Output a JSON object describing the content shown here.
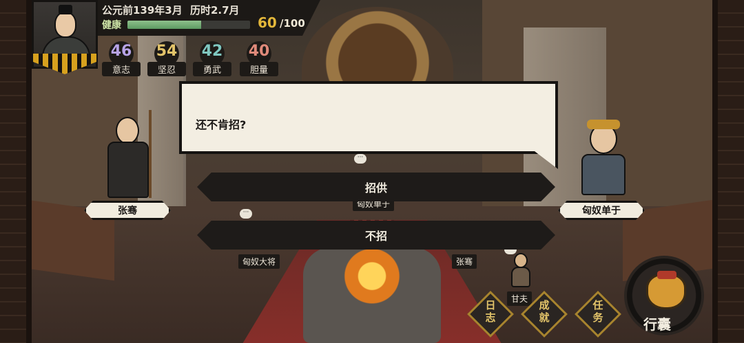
{
  "hud": {
    "date": "公元前139年3月",
    "elapsed": "历时2.7月",
    "health_label": "健康",
    "health_value": "60",
    "health_max": "/100",
    "health_fraction": 0.6
  },
  "stats": [
    {
      "value": "46",
      "label": "意志",
      "color": "#b7a3e6"
    },
    {
      "value": "54",
      "label": "坚忍",
      "color": "#e3c46a"
    },
    {
      "value": "42",
      "label": "勇武",
      "color": "#7fc7c0"
    },
    {
      "value": "40",
      "label": "胆量",
      "color": "#e08a7a"
    }
  ],
  "dialog": {
    "text": "还不肯招?"
  },
  "choices": [
    {
      "label": "招供"
    },
    {
      "label": "不招"
    }
  ],
  "characters": {
    "left_name": "张骞",
    "right_name": "匈奴单于",
    "center_back_tag": "匈奴单于",
    "general_tag": "匈奴大将",
    "zhangqian_tag": "张骞",
    "ganfu_tag": "甘夫"
  },
  "menu": {
    "log": "日\n志",
    "achievements": "成\n就",
    "tasks": "任\n务",
    "bag": "行囊"
  }
}
